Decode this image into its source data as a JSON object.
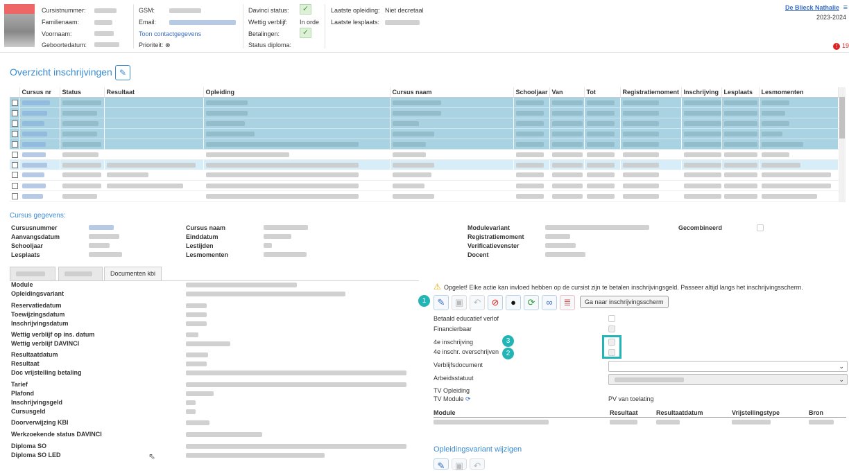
{
  "header": {
    "labels": {
      "cursistnummer": "Cursistnummer:",
      "familienaam": "Familienaam:",
      "voornaam": "Voornaam:",
      "geboortedatum": "Geboortedatum:",
      "gsm": "GSM:",
      "email": "Email:",
      "contact_link": "Toon contactgegevens",
      "prioriteit": "Prioriteit:",
      "davinci_status": "Davinci status:",
      "wettig_verblijf": "Wettig verblijf:",
      "wettig_value": "In orde",
      "betalingen": "Betalingen:",
      "status_diploma": "Status diploma:",
      "laatste_opleiding": "Laatste opleiding:",
      "laatste_opleiding_value": "Niet decretaal",
      "laatste_lesplaats": "Laatste lesplaats:"
    },
    "user": "De Blieck Nathalie",
    "year": "2023-2024",
    "notif": "19"
  },
  "overview": {
    "title": "Overzicht inschrijvingen",
    "columns": [
      "Cursus nr",
      "Status",
      "Resultaat",
      "Opleiding",
      "Cursus naam",
      "Schooljaar",
      "Van",
      "Tot",
      "Registratiemoment",
      "Inschrijving",
      "Lesplaats",
      "Lesmomenten"
    ],
    "row_types": [
      "sel",
      "sel",
      "sel",
      "sel",
      "sel",
      "plain",
      "hi",
      "plain",
      "plain",
      "plain"
    ]
  },
  "cursus": {
    "title": "Cursus gegevens:",
    "col1": [
      "Cursusnummer",
      "Aanvangsdatum",
      "Schooljaar",
      "Lesplaats"
    ],
    "col2": [
      "Cursus naam",
      "Einddatum",
      "Lestijden",
      "Lesmomenten"
    ],
    "col3": [
      "Modulevariant",
      "Registratiemoment",
      "Verificatievenster",
      "Docent"
    ],
    "gecombineerd": "Gecombineerd"
  },
  "tabs": {
    "third": "Documenten kbi"
  },
  "details": {
    "labels": [
      "Module",
      "Opleidingsvariant",
      "Reservatiedatum",
      "Toewijzingsdatum",
      "Inschrijvingsdatum",
      "Wettig verblijf op ins. datum",
      "Wettig verblijf DAVINCI",
      "Resultaatdatum",
      "Resultaat",
      "Doc vrijstelling betaling",
      "Tarief",
      "Plafond",
      "Inschrijvingsgeld",
      "Cursusgeld",
      "Doorverwijzing KBI",
      "Werkzoekende status DAVINCI",
      "Diploma SO",
      "Diploma SO LED"
    ]
  },
  "right": {
    "warning": "Opgelet! Elke actie kan invloed hebben op de cursist zijn te betalen inschrijvingsgeld. Passeer altijd langs het inschrijvingsscherm.",
    "goto_button": "Ga naar inschrijvingsscherm",
    "fields": [
      "Betaald educatief verlof",
      "Financierbaar",
      "4e inschrijving",
      "4e inschr. overschrijven",
      "Verblijfsdocument",
      "Arbeidsstatuut",
      "TV Opleiding",
      "TV Module"
    ],
    "pv": "PV van toelating",
    "table_headers": [
      "Module",
      "Resultaat",
      "Resultaatdatum",
      "Vrijstellingstype",
      "Bron"
    ],
    "variant_title": "Opleidingsvariant wijzigen",
    "badges": [
      "1",
      "2",
      "3"
    ]
  },
  "colors": {
    "accent": "#3b8bd0",
    "selected_row": "#a9d3e2",
    "badge": "#23b5b5"
  },
  "icons": [
    "edit-icon",
    "save-icon",
    "undo-icon",
    "cancel-icon",
    "bomb-icon",
    "refresh-icon",
    "link-icon",
    "document-icon",
    "warning-icon",
    "sign-doc-icon"
  ]
}
